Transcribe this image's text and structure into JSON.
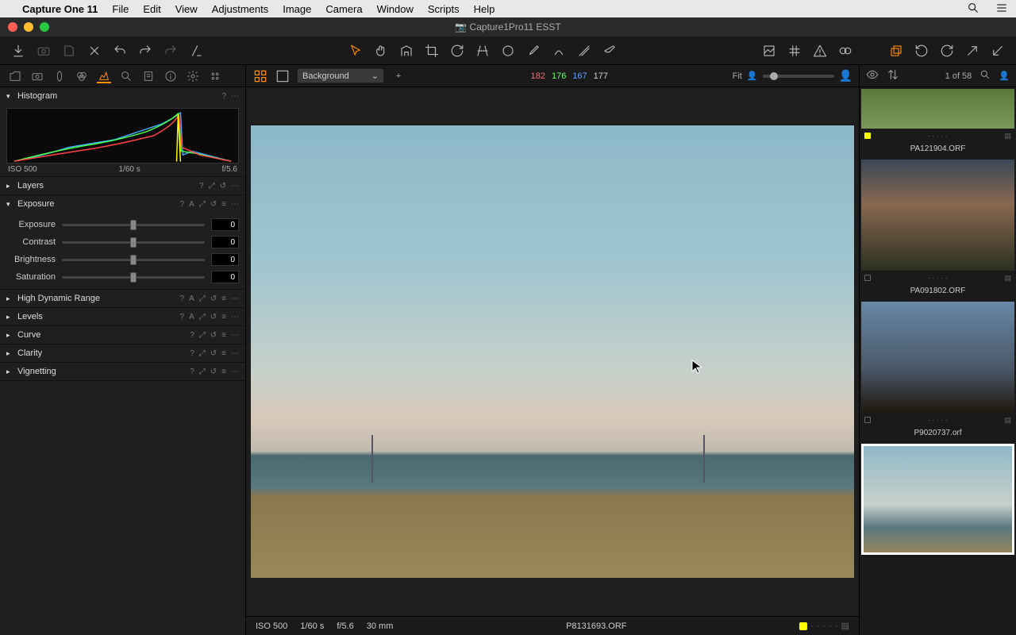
{
  "menubar": {
    "app": "Capture One 11",
    "items": [
      "File",
      "Edit",
      "View",
      "Adjustments",
      "Image",
      "Camera",
      "Window",
      "Scripts",
      "Help"
    ]
  },
  "titlebar": {
    "title": "Capture1Pro11 ESST"
  },
  "center_toolbar": {
    "layer_dropdown": "Background",
    "rgb": {
      "r": "182",
      "g": "176",
      "b": "167",
      "l": "177"
    },
    "fit_label": "Fit"
  },
  "right_top": {
    "position": "1 of 58"
  },
  "tools": {
    "histogram": {
      "title": "Histogram",
      "iso": "ISO 500",
      "shutter": "1/60 s",
      "aperture": "f/5.6"
    },
    "layers": {
      "title": "Layers"
    },
    "exposure": {
      "title": "Exposure",
      "sliders": [
        {
          "label": "Exposure",
          "value": "0"
        },
        {
          "label": "Contrast",
          "value": "0"
        },
        {
          "label": "Brightness",
          "value": "0"
        },
        {
          "label": "Saturation",
          "value": "0"
        }
      ]
    },
    "hdr": {
      "title": "High Dynamic Range"
    },
    "levels": {
      "title": "Levels"
    },
    "curve": {
      "title": "Curve"
    },
    "clarity": {
      "title": "Clarity"
    },
    "vignetting": {
      "title": "Vignetting"
    }
  },
  "viewer_meta": {
    "iso": "ISO 500",
    "shutter": "1/60 s",
    "aperture": "f/5.6",
    "focal": "30 mm",
    "filename": "P8131693.ORF"
  },
  "thumbs": [
    {
      "file": "PA121904.ORF"
    },
    {
      "file": "PA091802.ORF"
    },
    {
      "file": "P9020737.orf"
    },
    {
      "file": ""
    }
  ]
}
